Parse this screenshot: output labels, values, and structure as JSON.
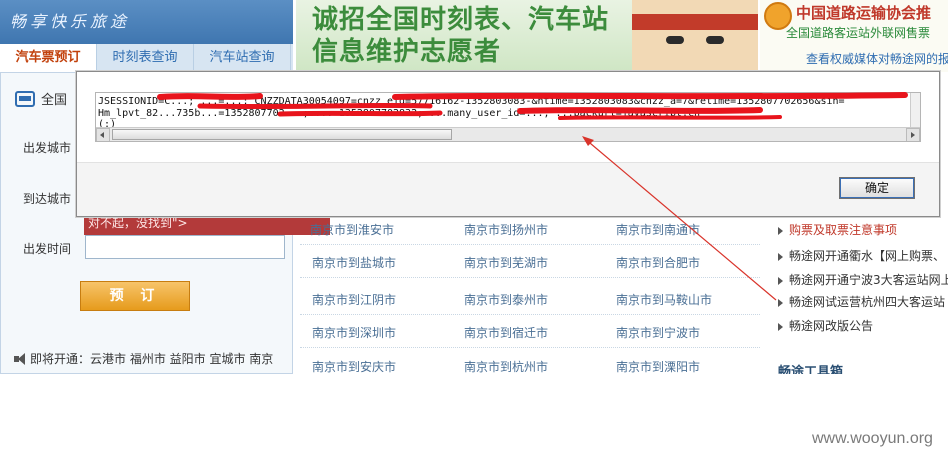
{
  "left_panel": {
    "logo_text": "畅享快乐旅途",
    "tabs": [
      "汽车票预订",
      "时刻表查询",
      "汽车站查询"
    ],
    "scope_label": "全国",
    "departure_city_label": "出发城市",
    "arrival_city_label": "到达城市",
    "departure_time_label": "出发时间",
    "error_text": "对不起，没找到\">",
    "book_button": "预 订",
    "coming_soon": "即将开通：",
    "coming_cities": "云港市 福州市 益阳市 宜城市 南京"
  },
  "banner": {
    "line1": "诚招全国时刻表、汽车站",
    "line2": "信息维护志愿者"
  },
  "right_banner": {
    "title": "中国道路运输协会推",
    "subtitle": "全国道路客运站外联网售票",
    "link": "查看权威媒体对畅途网的报"
  },
  "routes": [
    [
      "南京市到淮安市",
      "南京市到扬州市",
      "南京市到南通市"
    ],
    [
      "南京市到盐城市",
      "南京市到芜湖市",
      "南京市到合肥市"
    ],
    [
      "南京市到江阴市",
      "南京市到泰州市",
      "南京市到马鞍山市"
    ],
    [
      "南京市到深圳市",
      "南京市到宿迁市",
      "南京市到宁波市"
    ],
    [
      "南京市到安庆市",
      "南京市到杭州市",
      "南京市到溧阳市"
    ]
  ],
  "news": [
    "购票及取票注意事项",
    "畅途网开通衢水【网上购票、",
    "畅途网开通宁波3大客运站网上",
    "畅途网试运营杭州四大客运站",
    "畅途网改版公告"
  ],
  "tools_title": "畅途工具箱",
  "dialog": {
    "cookie_line1": "JSESSIONID=C...; ...=...; CNZZDATA30054097=cnzz_eid=57716162-1352803083-&ntime=1352803083&cnzz_a=7&retime=1352807702656&sin=",
    "cookie_line2": "Hm_lpvt_82...735b...=1352807702...; ...=1352807702832; ...many_user_id=...; ...backurl=javascript:ch",
    "cookie_line3": "(;)",
    "ok_button": "确定"
  },
  "watermark": "www.wooyun.org",
  "colors": {
    "redaction": "#e8141c",
    "arrow": "#d9342b",
    "accent": "#2f6db1"
  }
}
